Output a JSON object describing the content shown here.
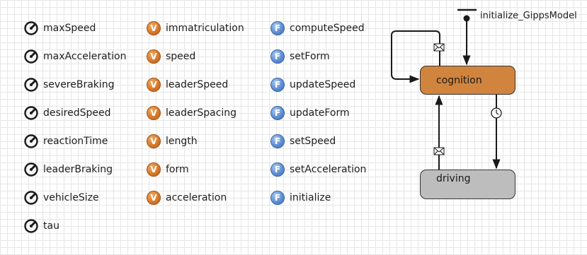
{
  "parameters": [
    {
      "label": "maxSpeed",
      "icon": "parameter-icon"
    },
    {
      "label": "maxAcceleration",
      "icon": "parameter-icon"
    },
    {
      "label": "severeBraking",
      "icon": "parameter-icon"
    },
    {
      "label": "desiredSpeed",
      "icon": "parameter-icon"
    },
    {
      "label": "reactionTime",
      "icon": "parameter-icon"
    },
    {
      "label": "leaderBraking",
      "icon": "parameter-icon"
    },
    {
      "label": "vehicleSize",
      "icon": "parameter-icon"
    },
    {
      "label": "tau",
      "icon": "parameter-icon"
    }
  ],
  "variables": [
    {
      "label": "immatriculation",
      "icon": "variable-icon",
      "glyph": "V"
    },
    {
      "label": "speed",
      "icon": "variable-icon",
      "glyph": "V"
    },
    {
      "label": "leaderSpeed",
      "icon": "variable-icon",
      "glyph": "V"
    },
    {
      "label": "leaderSpacing",
      "icon": "variable-icon",
      "glyph": "V"
    },
    {
      "label": "length",
      "icon": "variable-icon",
      "glyph": "V"
    },
    {
      "label": "form",
      "icon": "variable-icon",
      "glyph": "V"
    },
    {
      "label": "acceleration",
      "icon": "variable-icon",
      "glyph": "V"
    }
  ],
  "functions": [
    {
      "label": "computeSpeed",
      "icon": "function-icon",
      "glyph": "F"
    },
    {
      "label": "setForm",
      "icon": "function-icon",
      "glyph": "F"
    },
    {
      "label": "updateSpeed",
      "icon": "function-icon",
      "glyph": "F"
    },
    {
      "label": "updateForm",
      "icon": "function-icon",
      "glyph": "F"
    },
    {
      "label": "setSpeed",
      "icon": "function-icon",
      "glyph": "F"
    },
    {
      "label": "setAcceleration",
      "icon": "function-icon",
      "glyph": "F"
    },
    {
      "label": "initialize",
      "icon": "function-icon",
      "glyph": "F"
    }
  ],
  "statechart": {
    "entry_label": "initialize_GippsModel",
    "states": {
      "cognition": "cognition",
      "driving": "driving"
    },
    "transitions": [
      {
        "from": "cognition",
        "to": "cognition",
        "trigger_icon": "message-icon"
      },
      {
        "from": "cognition",
        "to": "driving",
        "trigger_icon": "timeout-icon"
      },
      {
        "from": "driving",
        "to": "cognition",
        "trigger_icon": "message-icon"
      }
    ]
  },
  "colors": {
    "cognition_fill": "#d1843d",
    "driving_fill": "#bdbdbd",
    "variable_icon": "#d77a2a",
    "function_icon": "#5f90d4",
    "grid": "#e6e6e6"
  }
}
